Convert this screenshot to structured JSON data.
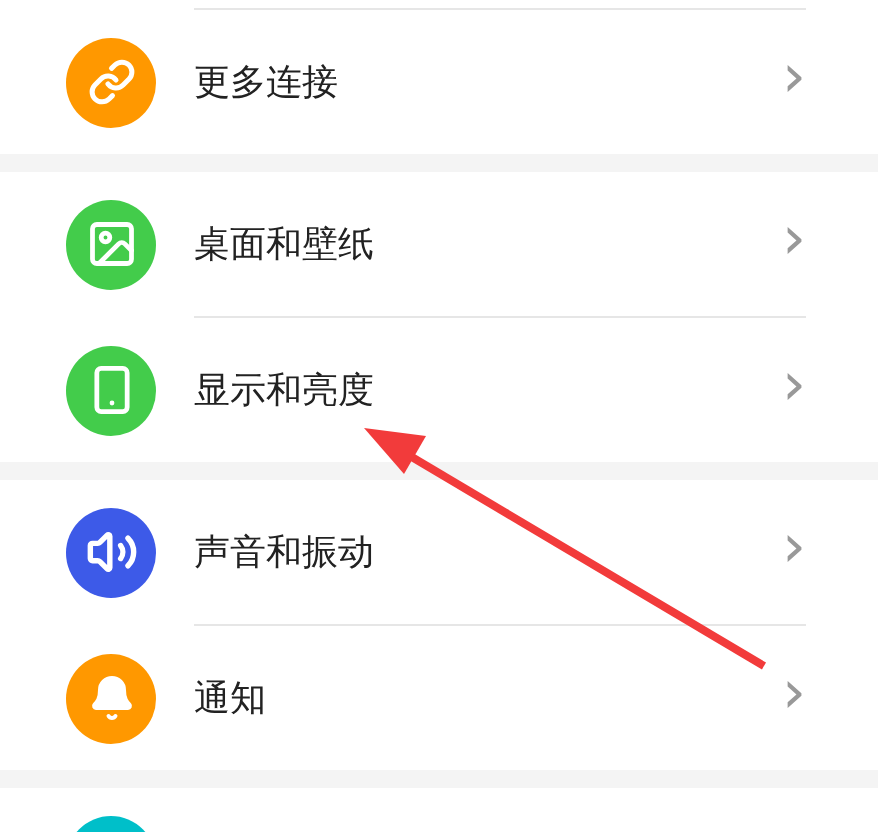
{
  "sections": [
    {
      "items": [
        {
          "kind": "link",
          "color": "#ff9800",
          "label": "更多连接",
          "chevron": "›"
        }
      ]
    },
    {
      "items": [
        {
          "kind": "wallpaper",
          "color": "#43cc4b",
          "label": "桌面和壁纸",
          "chevron": "›"
        },
        {
          "kind": "display",
          "color": "#43cc4b",
          "label": "显示和亮度",
          "chevron": "›"
        }
      ]
    },
    {
      "items": [
        {
          "kind": "sound",
          "color": "#3d5ae8",
          "label": "声音和振动",
          "chevron": "›"
        },
        {
          "kind": "notification",
          "color": "#ff9800",
          "label": "通知",
          "chevron": "›"
        }
      ]
    },
    {
      "items": [
        {
          "kind": "partial",
          "color": "#00bfc9"
        }
      ]
    }
  ]
}
